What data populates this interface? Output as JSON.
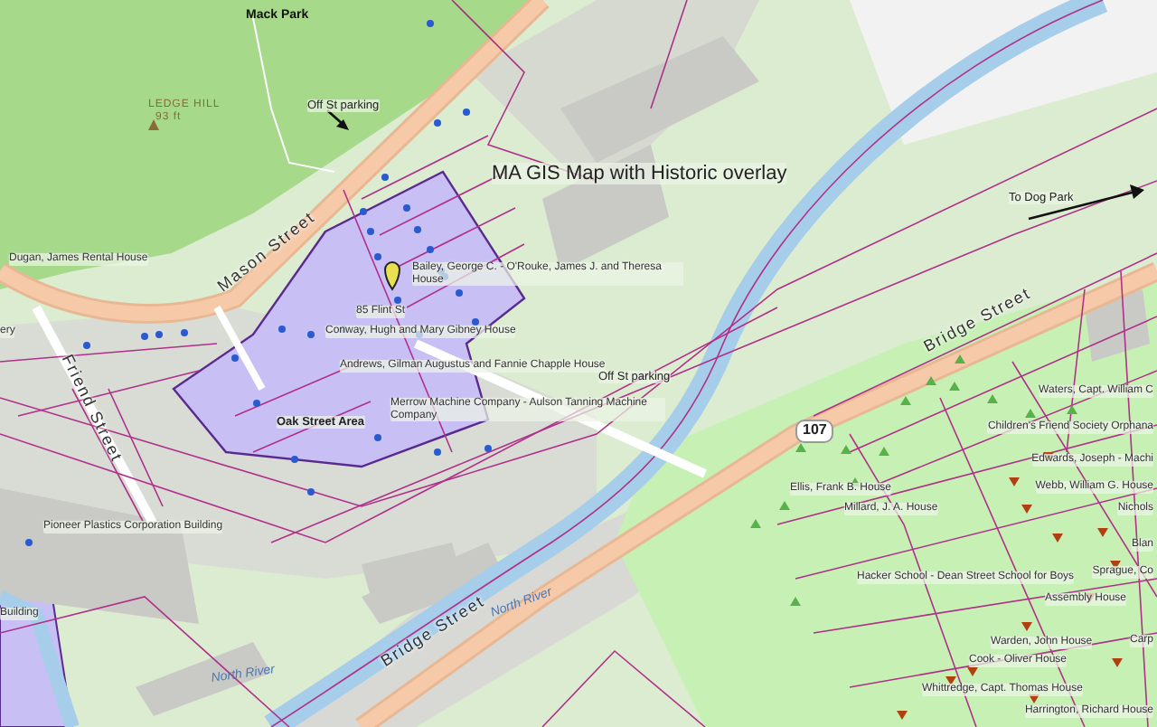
{
  "map": {
    "labels": [
      {
        "text": "Mack Park",
        "kind": "place"
      },
      {
        "text": "LEDGE HILL",
        "kind": "peak"
      },
      {
        "text": "93 ft",
        "kind": "peak"
      },
      {
        "text": "Off St parking",
        "kind": "note"
      },
      {
        "text": "MA GIS Map with Historic overlay",
        "kind": "title"
      },
      {
        "text": "To Dog Park",
        "kind": "note"
      },
      {
        "text": "Mason Street",
        "kind": "street"
      },
      {
        "text": "Dugan, James Rental House",
        "kind": "site"
      },
      {
        "text": "Bailey, George C. - O'Rouke, James J. and Theresa House",
        "kind": "site"
      },
      {
        "text": "85 Flint St",
        "kind": "site"
      },
      {
        "text": "ery",
        "kind": "site"
      },
      {
        "text": "Conway, Hugh and Mary Gibney House",
        "kind": "site"
      },
      {
        "text": "Friend Street",
        "kind": "street"
      },
      {
        "text": "Andrews, Gilman Augustus and Fannie Chapple House",
        "kind": "site"
      },
      {
        "text": "Off St parking",
        "kind": "note"
      },
      {
        "text": "Merrow Machine Company - Aulson Tanning Machine Company",
        "kind": "site"
      },
      {
        "text": "Oak Street Area",
        "kind": "area"
      },
      {
        "text": "Pioneer Plastics Corporation Building",
        "kind": "site"
      },
      {
        "text": "Building",
        "kind": "site"
      },
      {
        "text": "North River",
        "kind": "river"
      },
      {
        "text": "North River",
        "kind": "river"
      },
      {
        "text": "Bridge Street",
        "kind": "street"
      },
      {
        "text": "Bridge Street",
        "kind": "street"
      },
      {
        "text": "107",
        "kind": "route"
      },
      {
        "text": "Waters, Capt. William C",
        "kind": "site"
      },
      {
        "text": "Children's Friend Society Orphana",
        "kind": "site"
      },
      {
        "text": "Edwards, Joseph - Machi",
        "kind": "site"
      },
      {
        "text": "Webb, William G. House",
        "kind": "site"
      },
      {
        "text": "Nichols",
        "kind": "site"
      },
      {
        "text": "Ellis, Frank B. House",
        "kind": "site"
      },
      {
        "text": "Millard, J. A. House",
        "kind": "site"
      },
      {
        "text": "Blan",
        "kind": "site"
      },
      {
        "text": "Sprague, Co",
        "kind": "site"
      },
      {
        "text": "Hacker School - Dean Street School for Boys",
        "kind": "site"
      },
      {
        "text": "Assembly House",
        "kind": "site"
      },
      {
        "text": "Carp",
        "kind": "site"
      },
      {
        "text": "Warden, John House",
        "kind": "site"
      },
      {
        "text": "Cook - Oliver House",
        "kind": "site"
      },
      {
        "text": "Whittredge, Capt. Thomas House",
        "kind": "site"
      },
      {
        "text": "Harrington, Richard House",
        "kind": "site"
      }
    ]
  }
}
